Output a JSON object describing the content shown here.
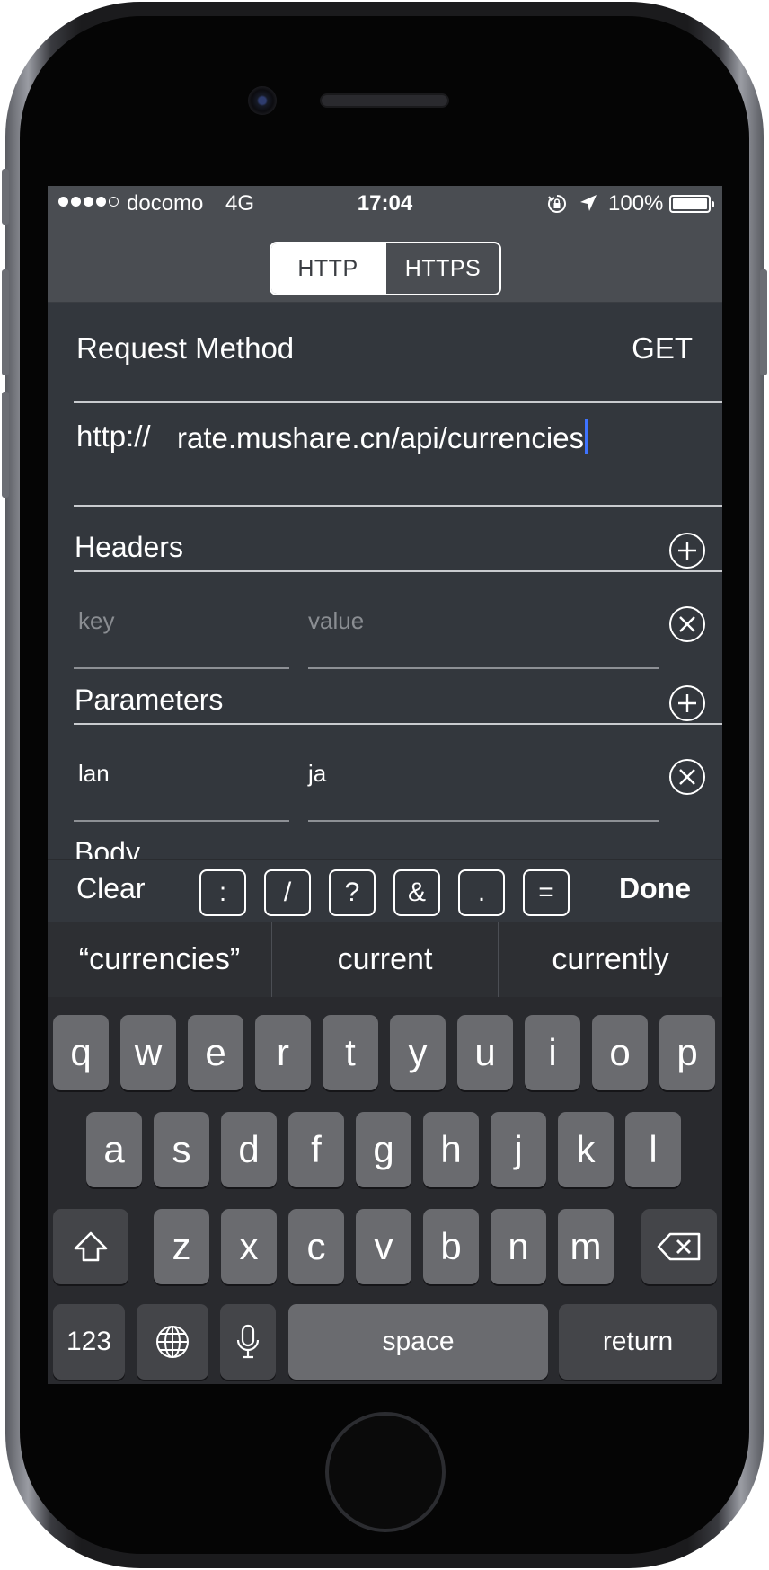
{
  "status_bar": {
    "signal_bars_filled": 4,
    "signal_bars_total": 5,
    "carrier": "docomo",
    "network": "4G",
    "time": "17:04",
    "icons": [
      "orientation-lock-icon",
      "location-arrow-icon"
    ],
    "battery_percent": "100%",
    "battery_level": 1.0
  },
  "protocol_switch": {
    "options": [
      "HTTP",
      "HTTPS"
    ],
    "selected": "HTTP"
  },
  "request": {
    "method_label": "Request Method",
    "method_value": "GET",
    "url_prefix": "http://",
    "url_value": "rate.mushare.cn/api/currencies"
  },
  "headers": {
    "title": "Headers",
    "add_icon": "plus-circle-icon",
    "rows": [
      {
        "key_placeholder": "key",
        "value_placeholder": "value",
        "remove_icon": "x-circle-icon"
      }
    ]
  },
  "parameters": {
    "title": "Parameters",
    "add_icon": "plus-circle-icon",
    "rows": [
      {
        "key": "lan",
        "value": "ja",
        "remove_icon": "x-circle-icon"
      }
    ]
  },
  "body_section": {
    "title": "Body"
  },
  "accessory_bar": {
    "clear_label": "Clear",
    "symbols": [
      ":",
      "/",
      "?",
      "&",
      ".",
      "="
    ],
    "done_label": "Done"
  },
  "suggestions": [
    "“currencies”",
    "current",
    "currently"
  ],
  "keyboard": {
    "row1": [
      "q",
      "w",
      "e",
      "r",
      "t",
      "y",
      "u",
      "i",
      "o",
      "p"
    ],
    "row2": [
      "a",
      "s",
      "d",
      "f",
      "g",
      "h",
      "j",
      "k",
      "l"
    ],
    "row3": [
      "z",
      "x",
      "c",
      "v",
      "b",
      "n",
      "m"
    ],
    "shift_icon": "shift-arrow-icon",
    "delete_icon": "backspace-icon",
    "numbers_label": "123",
    "globe_icon": "globe-icon",
    "mic_icon": "microphone-icon",
    "space_label": "space",
    "return_label": "return"
  },
  "colors": {
    "screen_bg": "#33373d",
    "nav_bg": "#4a4d52",
    "caret": "#3e73ff",
    "keyboard_bg": "#292a2e",
    "key_bg": "#6a6b6f"
  }
}
